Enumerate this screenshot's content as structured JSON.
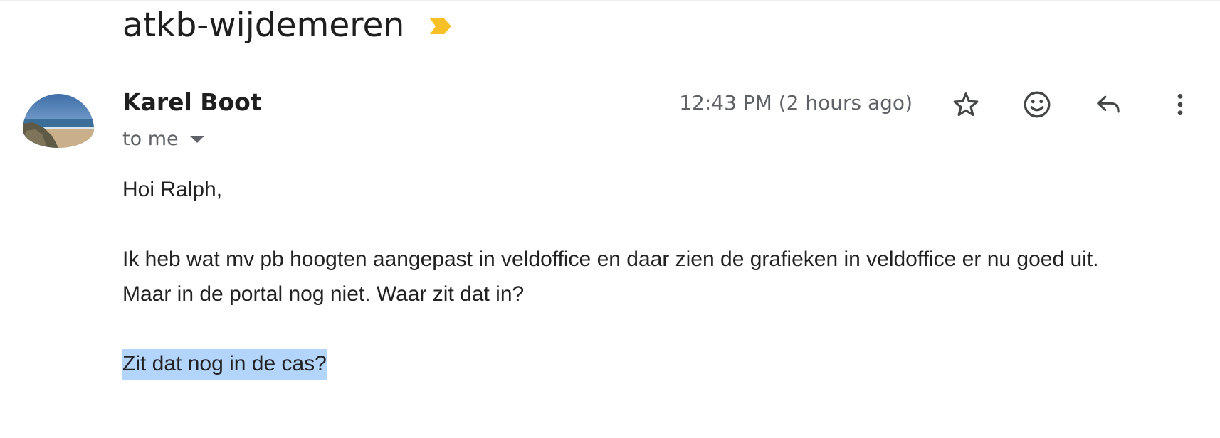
{
  "subject": {
    "text": "atkb-wijdemeren",
    "importance_icon": "important-marker-icon",
    "importance_color": "#f6c026"
  },
  "message": {
    "sender_name": "Karel Boot",
    "recipient_label": "to me",
    "timestamp": "12:43 PM (2 hours ago)",
    "avatar_icon": "beach-photo-avatar"
  },
  "actions": {
    "star_icon": "star-outline-icon",
    "emoji_icon": "emoji-reaction-icon",
    "reply_icon": "reply-icon",
    "more_icon": "more-vert-icon"
  },
  "body": {
    "greeting": "Hoi Ralph,",
    "line1": "Ik heb wat mv pb hoogten aangepast in veldoffice en daar zien de grafieken in veldoffice er nu goed uit.",
    "line2": "Maar in de portal nog niet. Waar zit dat in?",
    "selected_line": "Zit dat nog in de cas?"
  },
  "colors": {
    "selection_highlight": "#b3d5fb",
    "secondary_text": "#5f6368"
  }
}
